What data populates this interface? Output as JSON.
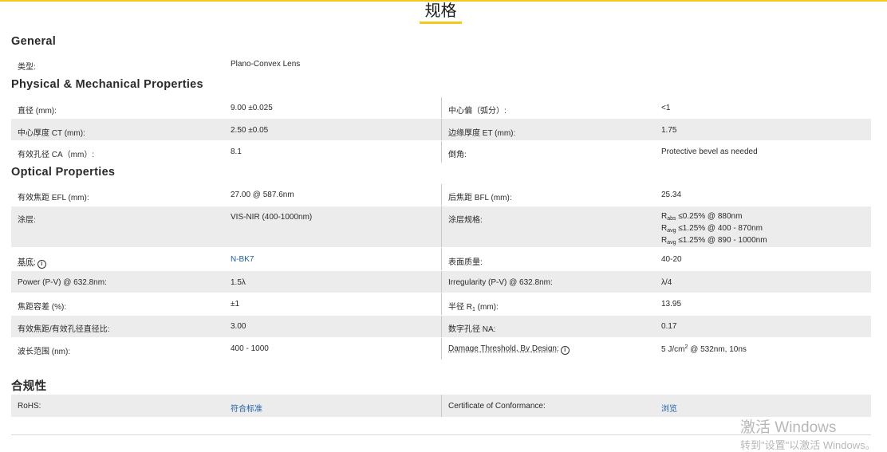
{
  "title": "规格",
  "sections": {
    "general": "General",
    "physical": "Physical & Mechanical Properties",
    "optical": "Optical Properties",
    "compliance": "合规性"
  },
  "general": {
    "type_label": "类型:",
    "type_value": "Plano-Convex Lens"
  },
  "physical": {
    "diameter_label": "直径 (mm):",
    "diameter_value": "9.00 ±0.025",
    "centering_label": "中心偏（弧分）:",
    "centering_value": "<1",
    "ct_label": "中心厚度 CT (mm):",
    "ct_value": "2.50 ±0.05",
    "et_label": "边缘厚度 ET (mm):",
    "et_value": "1.75",
    "ca_label": "有效孔径 CA（mm）:",
    "ca_value": "8.1",
    "bevel_label": "倒角:",
    "bevel_value": "Protective bevel as needed"
  },
  "optical": {
    "efl_label": "有效焦距 EFL (mm):",
    "efl_value": "27.00 @ 587.6nm",
    "bfl_label": "后焦距 BFL (mm):",
    "bfl_value": "25.34",
    "coating_label": "涂层:",
    "coating_value": "VIS-NIR (400-1000nm)",
    "coating_spec_label": "涂层规格:",
    "coating_spec": {
      "line1_prefix": "R",
      "line1_sub": "abs",
      "line1_text": " ≤0.25% @ 880nm",
      "line2_prefix": "R",
      "line2_sub": "avg",
      "line2_text": " ≤1.25% @ 400 - 870nm",
      "line3_prefix": "R",
      "line3_sub": "avg",
      "line3_text": " ≤1.25% @ 890 - 1000nm"
    },
    "substrate_label": "基底:",
    "substrate_value": "N-BK7",
    "surface_label": "表面质量:",
    "surface_value": "40-20",
    "power_label": "Power (P-V) @ 632.8nm:",
    "power_value": "1.5λ",
    "irregularity_label": "Irregularity (P-V) @ 632.8nm:",
    "irregularity_value": "λ/4",
    "fl_tol_label": "焦距容差 (%):",
    "fl_tol_value": "±1",
    "radius_label_pre": "半径 R",
    "radius_label_sub": "1",
    "radius_label_post": " (mm):",
    "radius_value": "13.95",
    "fnum_label": "有效焦距/有效孔径直径比:",
    "fnum_value": "3.00",
    "na_label": "数字孔径 NA:",
    "na_value": "0.17",
    "wavelength_label": "波长范围 (nm):",
    "wavelength_value": "400 - 1000",
    "damage_label": "Damage Threshold, By Design:",
    "damage_value_pre": "5 J/cm",
    "damage_value_sup": "2",
    "damage_value_post": " @ 532nm, 10ns"
  },
  "compliance": {
    "rohs_label": "RoHS:",
    "rohs_value": "符合标准",
    "cert_label": "Certificate of Conformance:",
    "cert_value": "浏览"
  },
  "watermark": {
    "line1": "激活 Windows",
    "line2": "转到\"设置\"以激活 Windows。"
  }
}
